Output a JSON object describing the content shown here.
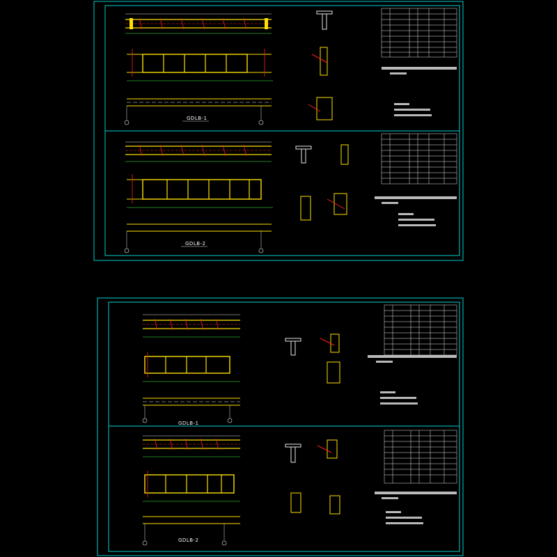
{
  "colors": {
    "background": "#000000",
    "frame": "#00d0d0",
    "beam_yellow": "#ffe000",
    "rebar_red": "#ff2020",
    "dimension_green": "#40ff40",
    "dimension_white": "#e8e8e8",
    "text_white": "#ffffff"
  },
  "sheets": [
    {
      "name": "sheet-top",
      "panels": [
        {
          "beam_title": "GDLB-1"
        },
        {
          "beam_title": "GDLB-2"
        }
      ]
    },
    {
      "name": "sheet-bottom",
      "panels": [
        {
          "beam_title": "GDLB-1"
        },
        {
          "beam_title": "GDLB-2"
        }
      ]
    }
  ]
}
